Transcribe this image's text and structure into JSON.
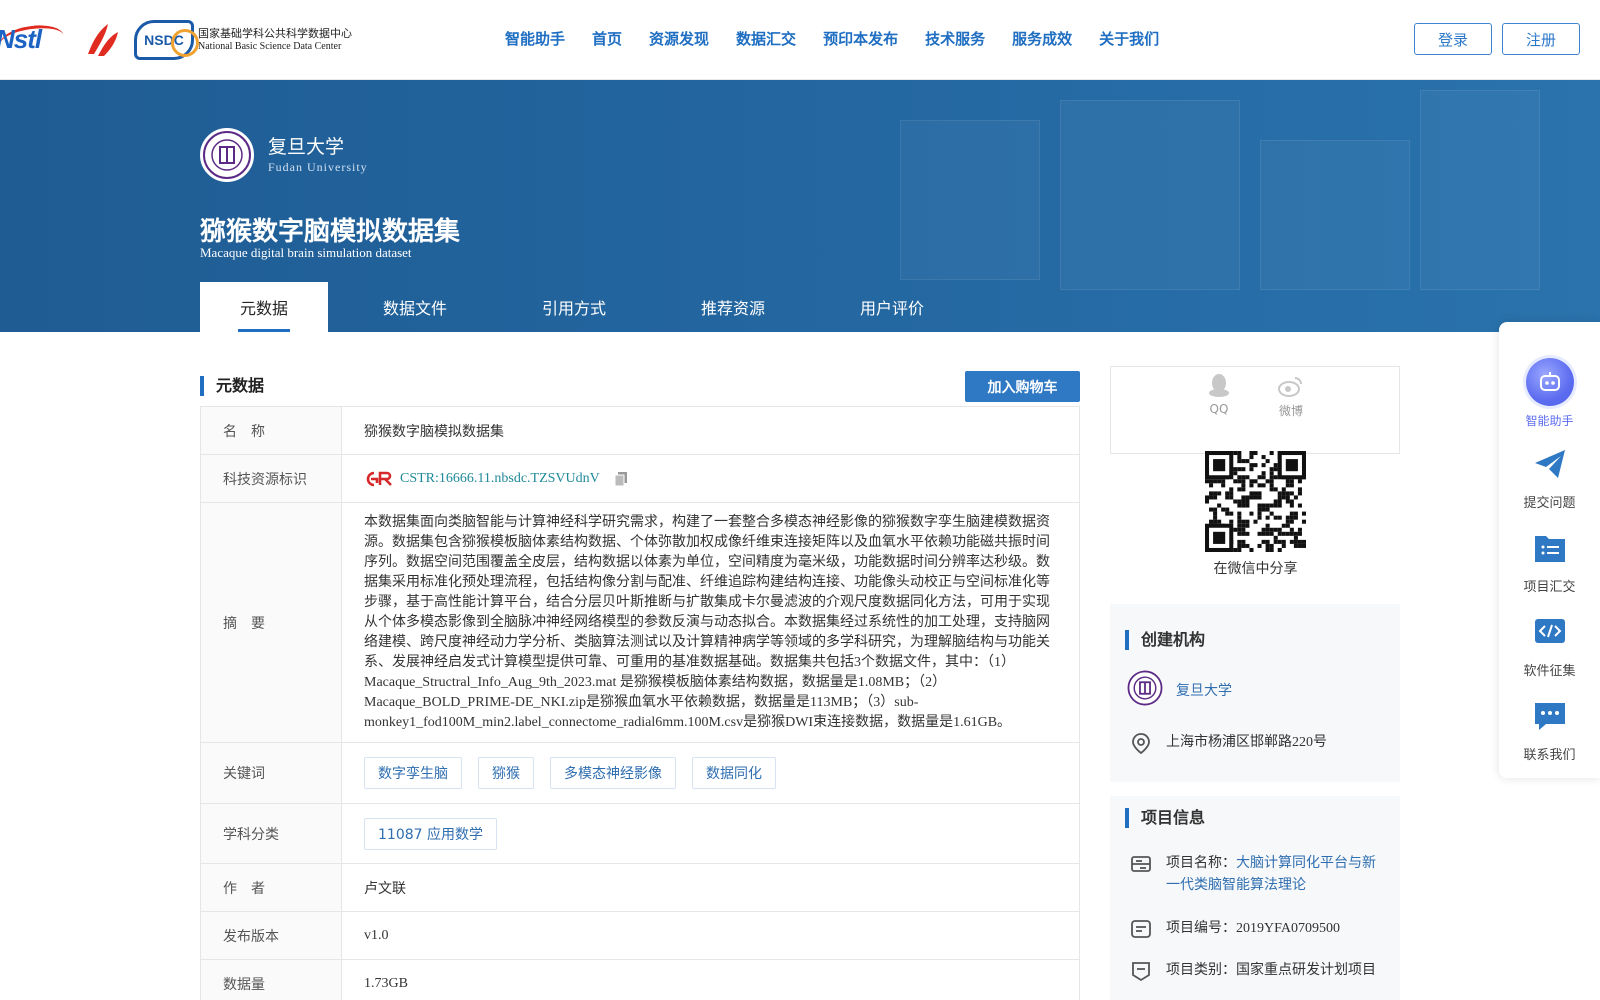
{
  "nav": {
    "items": [
      "智能助手",
      "首页",
      "资源发现",
      "数据汇交",
      "预印本发布",
      "技术服务",
      "服务成效",
      "关于我们"
    ],
    "login": "登录",
    "register": "注册",
    "logos": {
      "nstl": "Nstl",
      "nsdc_badge": "NSDC",
      "nsdc_cn": "国家基础学科公共科学数据中心",
      "nsdc_en": "National Basic Science Data Center"
    }
  },
  "banner": {
    "org_cn": "复旦大学",
    "org_en": "Fudan University",
    "title_cn": "猕猴数字脑模拟数据集",
    "title_en": "Macaque digital brain simulation dataset",
    "tabs": [
      "元数据",
      "数据文件",
      "引用方式",
      "推荐资源",
      "用户评价"
    ],
    "active_tab": 0
  },
  "metadata": {
    "section_title": "元数据",
    "cart_button": "加入购物车",
    "labels": {
      "name": "名　称",
      "cstr": "科技资源标识",
      "abstract": "摘　要",
      "keywords": "关键词",
      "subject": "学科分类",
      "author": "作　者",
      "version": "发布版本",
      "size": "数据量"
    },
    "name": "猕猴数字脑模拟数据集",
    "cstr": "CSTR:16666.11.nbsdc.TZSVUdnV",
    "abstract": "本数据集面向类脑智能与计算神经科学研究需求，构建了一套整合多模态神经影像的猕猴数字孪生脑建模数据资源。数据集包含猕猴模板脑体素结构数据、个体弥散加权成像纤维束连接矩阵以及血氧水平依赖功能磁共振时间序列。数据空间范围覆盖全皮层，结构数据以体素为单位，空间精度为毫米级，功能数据时间分辨率达秒级。数据集采用标准化预处理流程，包括结构像分割与配准、纤维追踪构建结构连接、功能像头动校正与空间标准化等步骤，基于高性能计算平台，结合分层贝叶斯推断与扩散集成卡尔曼滤波的介观尺度数据同化方法，可用于实现从个体多模态影像到全脑脉冲神经网络模型的参数反演与动态拟合。本数据集经过系统性的加工处理，支持脑网络建模、跨尺度神经动力学分析、类脑算法测试以及计算精神病学等领域的多学科研究，为理解脑结构与功能关系、发展神经启发式计算模型提供可靠、可重用的基准数据基础。数据集共包括3个数据文件，其中：（1）Macaque_Structral_Info_Aug_9th_2023.mat 是猕猴模板脑体素结构数据，数据量是1.08MB；（2）Macaque_BOLD_PRIME-DE_NKI.zip是猕猴血氧水平依赖数据，数据量是113MB；（3）sub-monkey1_fod100M_min2.label_connectome_radial6mm.100M.csv是猕猴DWI束连接数据，数据量是1.61GB。",
    "keywords": [
      "数字孪生脑",
      "猕猴",
      "多模态神经影像",
      "数据同化"
    ],
    "subject": "11087 应用数学",
    "author": "卢文联",
    "version": "v1.0",
    "size": "1.73GB"
  },
  "share": {
    "qq": "QQ",
    "weibo": "微博",
    "wechat_caption": "在微信中分享"
  },
  "creator": {
    "title": "创建机构",
    "org": "复旦大学",
    "address": "上海市杨浦区邯郸路220号"
  },
  "project": {
    "title": "项目信息",
    "name_label": "项目名称：",
    "name_value": "大脑计算同化平台与新一代类脑智能算法理论",
    "number": "项目编号：2019YFA0709500",
    "category": "项目类别：国家重点研发计划项目"
  },
  "float_bar": {
    "items": [
      "智能助手",
      "提交问题",
      "项目汇交",
      "软件征集",
      "联系我们"
    ]
  },
  "colors": {
    "brand_blue": "#1f6ec2",
    "banner_blue": "#23659f",
    "ai_purple": "#5d6df0"
  }
}
